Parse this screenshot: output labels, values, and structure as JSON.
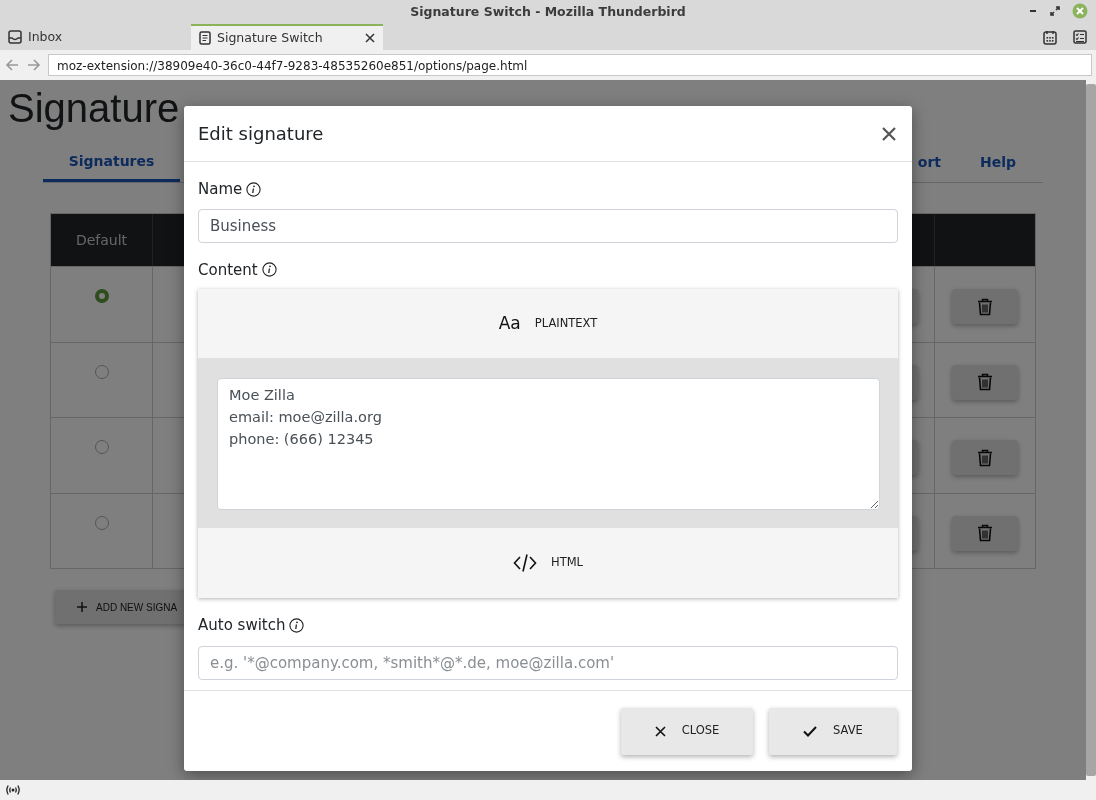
{
  "window": {
    "title": "Signature Switch - Mozilla Thunderbird"
  },
  "tabs": [
    {
      "label": "Inbox",
      "selected": false,
      "kind": "mail"
    },
    {
      "label": "Signature Switch",
      "selected": true,
      "kind": "page"
    }
  ],
  "address_bar": {
    "url": "moz-extension://38909e40-36c0-44f7-9283-48535260e851/options/page.html"
  },
  "page": {
    "title": "Signature",
    "nav": [
      {
        "label": "Signatures",
        "selected": true
      },
      {
        "label": "ort",
        "selected": false
      },
      {
        "label": "Help",
        "selected": false
      }
    ],
    "table": {
      "columns": [
        "Default"
      ],
      "rows": [
        {
          "default": true
        },
        {
          "default": false
        },
        {
          "default": false
        },
        {
          "default": false
        }
      ]
    },
    "add_button": "ADD NEW SIGNA"
  },
  "dialog": {
    "title": "Edit signature",
    "name": {
      "label": "Name",
      "value": "Business"
    },
    "content": {
      "label": "Content",
      "sections": [
        {
          "label": "PLAINTEXT",
          "kind": "plaintext",
          "icon": "Aa",
          "expanded": true,
          "value": "Moe Zilla\nemail: moe@zilla.org\nphone: (666) 12345"
        },
        {
          "label": "HTML",
          "kind": "html",
          "expanded": false
        }
      ]
    },
    "auto_switch": {
      "label": "Auto switch",
      "placeholder": "e.g. '*@company.com, *smith*@*.de, moe@zilla.com'"
    },
    "buttons": [
      {
        "label": "CLOSE",
        "kind": "close"
      },
      {
        "label": "SAVE",
        "kind": "save"
      }
    ]
  }
}
